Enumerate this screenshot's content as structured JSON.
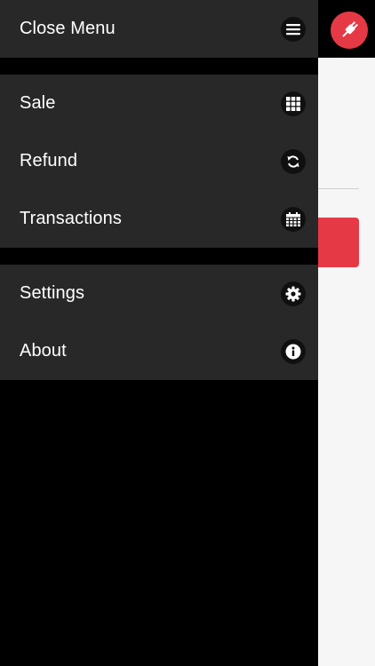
{
  "menu": {
    "close": {
      "label": "Close Menu",
      "icon": "hamburger-icon"
    },
    "primary": [
      {
        "label": "Sale",
        "icon": "grid-icon"
      },
      {
        "label": "Refund",
        "icon": "refresh-icon"
      },
      {
        "label": "Transactions",
        "icon": "calendar-icon"
      }
    ],
    "secondary": [
      {
        "label": "Settings",
        "icon": "gear-icon"
      },
      {
        "label": "About",
        "icon": "info-icon"
      }
    ]
  },
  "colors": {
    "accent": "#e63946",
    "drawer_bg": "#282828",
    "background": "#000000",
    "app_bg": "#f6f6f6"
  }
}
